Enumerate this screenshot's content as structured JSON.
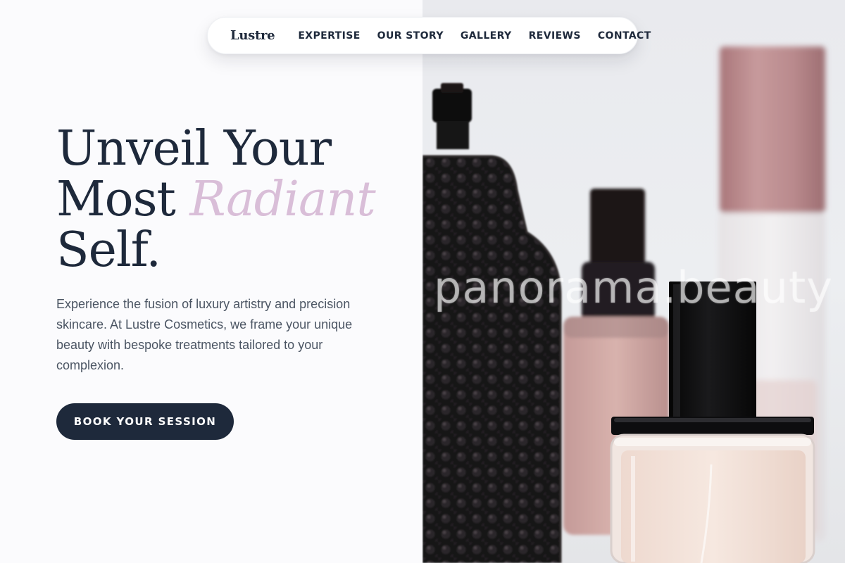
{
  "nav": {
    "brand": "Lustre",
    "links": [
      "EXPERTISE",
      "OUR STORY",
      "GALLERY",
      "REVIEWS",
      "CONTACT"
    ]
  },
  "hero": {
    "headline_line1": "Unveil Your",
    "headline_line2_plain": "Most ",
    "headline_line2_accent": "Radiant",
    "headline_line3": "Self.",
    "description": "Experience the fusion of luxury artistry and precision skincare. At Lustre Cosmetics, we frame your unique beauty with bespoke treatments tailored to your complexion.",
    "cta_label": "BOOK YOUR SESSION"
  },
  "image": {
    "watermark": "panorama.beauty"
  },
  "colors": {
    "primary_dark": "#1e293b",
    "accent_pink": "#d9bed8",
    "body_text": "#4b5563",
    "page_background": "#fbfbfd"
  },
  "icons": [
    "perfume-bottle-image"
  ]
}
